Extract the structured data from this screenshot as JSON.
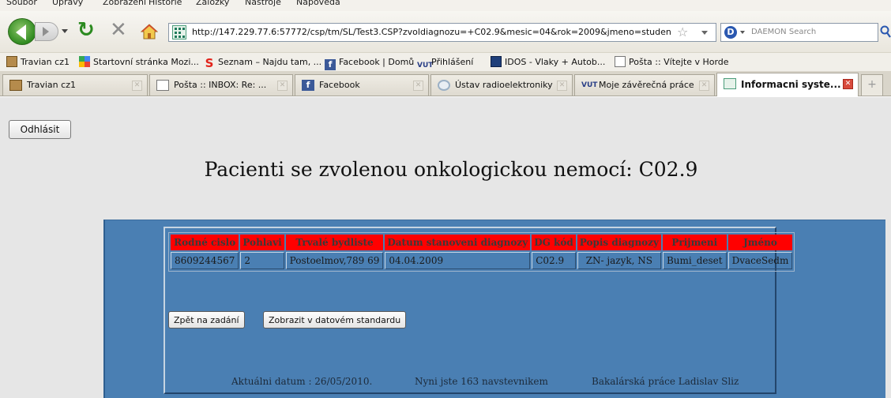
{
  "menubar": {
    "items": [
      "Soubor",
      "Úpravy",
      "Zobrazení",
      "Historie",
      "Záložky",
      "Nástroje",
      "Nápověda"
    ]
  },
  "navbar": {
    "url": "http://147.229.77.6:57772/csp/tm/SL/Test3.CSP?zvoldiagnozu=+C02.9&mesic=04&rok=2009&jmeno=student&t",
    "search_placeholder": "DAEMON Search"
  },
  "bookmarks": [
    {
      "label": "Travian cz1",
      "icon": "travian-icon"
    },
    {
      "label": "Startovní stránka Mozi...",
      "icon": "google-icon"
    },
    {
      "label": "Seznam – Najdu tam, ...",
      "icon": "seznam-icon"
    },
    {
      "label": "Facebook | Domů",
      "icon": "facebook-icon"
    },
    {
      "label": "Přihlášení",
      "icon": "vut-icon"
    },
    {
      "label": "IDOS - Vlaky + Autob...",
      "icon": "idos-icon"
    },
    {
      "label": "Pošta :: Vítejte v Horde",
      "icon": "mail-icon"
    }
  ],
  "tabs": [
    {
      "label": "Travian cz1",
      "icon": "travian-icon",
      "active": false
    },
    {
      "label": "Pošta :: INBOX: Re: ...",
      "icon": "mail-icon",
      "active": false
    },
    {
      "label": "Facebook",
      "icon": "facebook-icon",
      "active": false
    },
    {
      "label": "Ústav radioelektroniky",
      "icon": "radio-icon",
      "active": false
    },
    {
      "label": "Moje závěrečná práce",
      "icon": "vut-icon",
      "active": false
    },
    {
      "label": "Informacni syste...",
      "icon": "site-icon",
      "active": true
    }
  ],
  "page": {
    "logout_label": "Odhlásit",
    "title": "Pacienti se zvolenou onkologickou nemocí: C02.9",
    "table": {
      "headers": [
        "Rodné cislo",
        "Pohlavi",
        "Trvalé bydliste",
        "Datum stanoveni diagnozy",
        "DG kód",
        "Popis diagnozy",
        "Prijmeni",
        "Jméno"
      ],
      "rows": [
        [
          "8609244567",
          "2",
          "Postoelmov,789 69",
          "04.04.2009",
          "C02.9",
          "ZN- jazyk, NS",
          "Bumi_deset",
          "DvaceSedm"
        ]
      ]
    },
    "back_label": "Zpět na zadání",
    "standard_label": "Zobrazit v datovém standardu",
    "footer": {
      "date": "Aktuálni datum : 26/05/2010.",
      "visitor": "Nyni jste 163 navstevnikem",
      "author": "Bakalárská práce Ladislav Sliz"
    }
  },
  "colors": {
    "panel_blue": "#4a7fb3",
    "header_red": "#ff0000",
    "page_gray": "#e6e6e6"
  }
}
